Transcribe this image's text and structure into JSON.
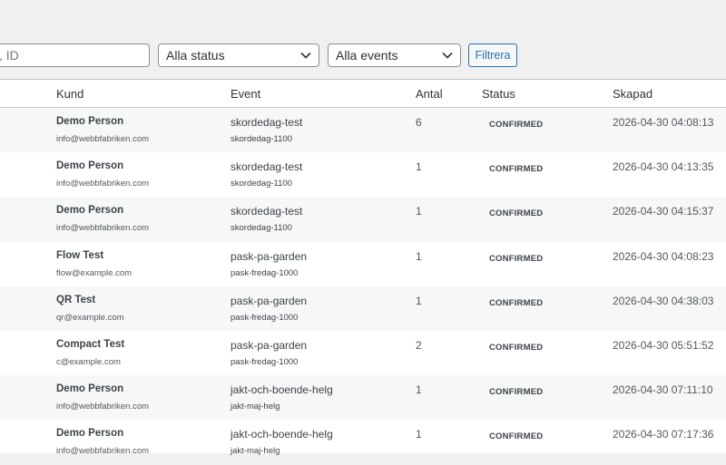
{
  "filters": {
    "search_placeholder": ", ID",
    "status_select": "Alla status",
    "event_select": "Alla events",
    "filter_button": "Filtrera"
  },
  "table": {
    "headers": {
      "kund": "Kund",
      "event": "Event",
      "antal": "Antal",
      "status": "Status",
      "skapad": "Skapad"
    },
    "rows": [
      {
        "name": "Demo Person",
        "email": "info@webbfabriken.com",
        "event": "skordedag-test",
        "slug": "skordedag-1100",
        "antal": "6",
        "status": "CONFIRMED",
        "skapad": "2026-04-30 04:08:13"
      },
      {
        "name": "Demo Person",
        "email": "info@webbfabriken.com",
        "event": "skordedag-test",
        "slug": "skordedag-1100",
        "antal": "1",
        "status": "CONFIRMED",
        "skapad": "2026-04-30 04:13:35"
      },
      {
        "name": "Demo Person",
        "email": "info@webbfabriken.com",
        "event": "skordedag-test",
        "slug": "skordedag-1100",
        "antal": "1",
        "status": "CONFIRMED",
        "skapad": "2026-04-30 04:15:37"
      },
      {
        "name": "Flow Test",
        "email": "flow@example.com",
        "event": "pask-pa-garden",
        "slug": "pask-fredag-1000",
        "antal": "1",
        "status": "CONFIRMED",
        "skapad": "2026-04-30 04:08:23"
      },
      {
        "name": "QR Test",
        "email": "qr@example.com",
        "event": "pask-pa-garden",
        "slug": "pask-fredag-1000",
        "antal": "1",
        "status": "CONFIRMED",
        "skapad": "2026-04-30 04:38:03"
      },
      {
        "name": "Compact Test",
        "email": "c@example.com",
        "event": "pask-pa-garden",
        "slug": "pask-fredag-1000",
        "antal": "2",
        "status": "CONFIRMED",
        "skapad": "2026-04-30 05:51:52"
      },
      {
        "name": "Demo Person",
        "email": "info@webbfabriken.com",
        "event": "jakt-och-boende-helg",
        "slug": "jakt-maj-helg",
        "antal": "1",
        "status": "CONFIRMED",
        "skapad": "2026-04-30 07:11:10"
      },
      {
        "name": "Demo Person",
        "email": "info@webbfabriken.com",
        "event": "jakt-och-boende-helg",
        "slug": "jakt-maj-helg",
        "antal": "1",
        "status": "CONFIRMED",
        "skapad": "2026-04-30 07:17:36"
      }
    ]
  }
}
